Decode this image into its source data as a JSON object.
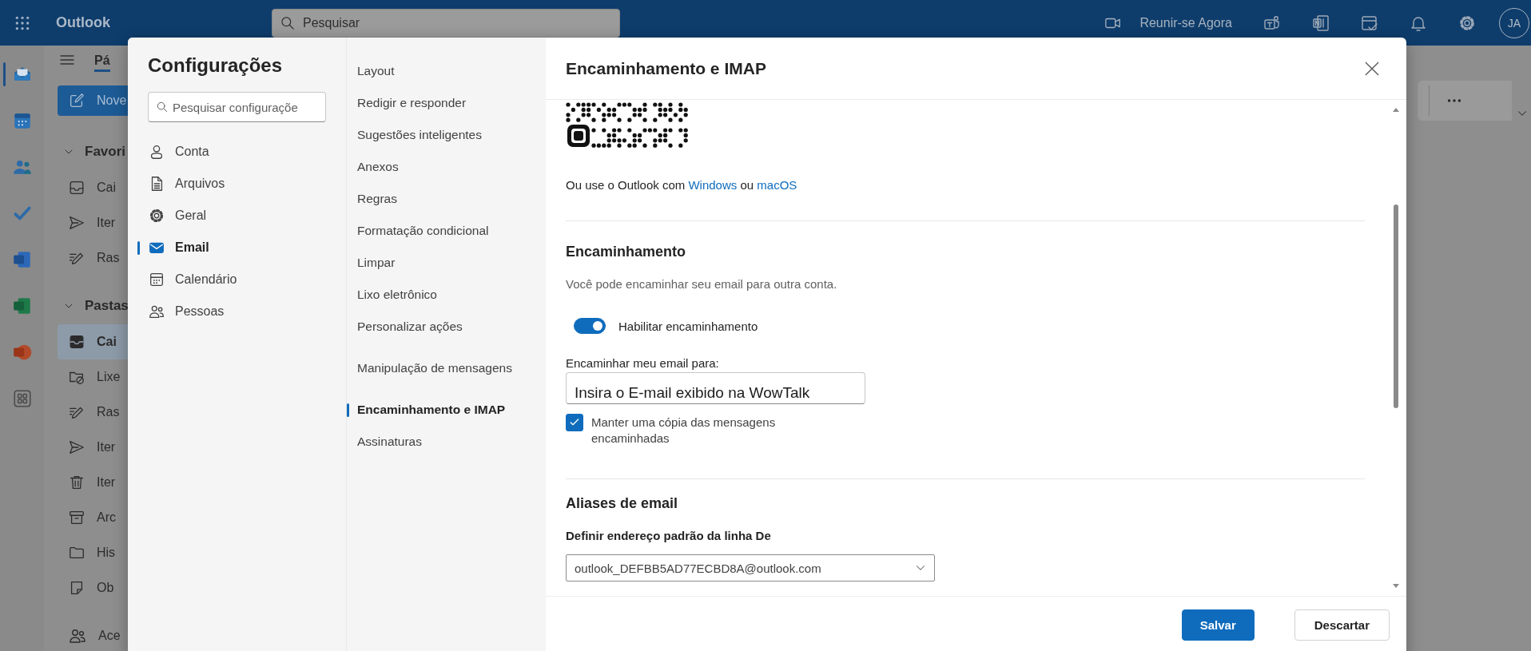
{
  "app": {
    "name": "Outlook",
    "search_placeholder": "Pesquisar",
    "meet_now": "Reunir-se Agora",
    "avatar": "JA",
    "toolbar_icons": [
      {
        "kind": "chat"
      },
      {
        "kind": "notebook"
      },
      {
        "kind": "task"
      },
      {
        "kind": "bell"
      },
      {
        "kind": "gear"
      }
    ]
  },
  "rail": [
    {
      "kind": "mail",
      "selected": true
    },
    {
      "kind": "calendar",
      "selected": false
    },
    {
      "kind": "people",
      "selected": false
    },
    {
      "kind": "check",
      "selected": false
    },
    {
      "kind": "doc",
      "selected": false
    },
    {
      "kind": "sheet",
      "selected": false
    },
    {
      "kind": "slides",
      "selected": false
    },
    {
      "kind": "apps",
      "selected": false
    }
  ],
  "folder_pane": {
    "tab": "Pá",
    "new_button": "Nove",
    "sections": [
      {
        "label": "Favori",
        "items": [
          {
            "kind": "inbox",
            "label": "Cai",
            "selected": false
          },
          {
            "kind": "send",
            "label": "Iter",
            "selected": false
          },
          {
            "kind": "draft",
            "label": "Ras",
            "selected": false
          }
        ]
      },
      {
        "label": "Pastas",
        "items": [
          {
            "kind": "inbox",
            "label": "Cai",
            "selected": true
          },
          {
            "kind": "junk",
            "label": "Lixe",
            "selected": false
          },
          {
            "kind": "draft",
            "label": "Ras",
            "selected": false
          },
          {
            "kind": "send",
            "label": "Iter",
            "selected": false
          },
          {
            "kind": "trash",
            "label": "Iter",
            "selected": false
          },
          {
            "kind": "archive",
            "label": "Arc",
            "selected": false
          },
          {
            "kind": "folder",
            "label": "His",
            "selected": false
          },
          {
            "kind": "note",
            "label": "Ob",
            "selected": false
          }
        ]
      }
    ],
    "footer_item": {
      "kind": "people",
      "label": "Ace"
    }
  },
  "settings": {
    "title": "Configurações",
    "search_placeholder": "Pesquisar configuraçõe",
    "categories": [
      {
        "kind": "person",
        "label": "Conta",
        "selected": false
      },
      {
        "kind": "doc",
        "label": "Arquivos",
        "selected": false
      },
      {
        "kind": "gear",
        "label": "Geral",
        "selected": false
      },
      {
        "kind": "mail",
        "label": "Email",
        "selected": true
      },
      {
        "kind": "calendar",
        "label": "Calendário",
        "selected": false
      },
      {
        "kind": "people",
        "label": "Pessoas",
        "selected": false
      }
    ],
    "subcategory_groups": [
      {
        "items": [
          {
            "label": "Layout",
            "selected": false
          },
          {
            "label": "Redigir e responder",
            "selected": false
          },
          {
            "label": "Sugestões inteligentes",
            "selected": false
          },
          {
            "label": "Anexos",
            "selected": false
          },
          {
            "label": "Regras",
            "selected": false
          },
          {
            "label": "Formatação condicional",
            "selected": false
          },
          {
            "label": "Limpar",
            "selected": false
          },
          {
            "label": "Lixo eletrônico",
            "selected": false
          },
          {
            "label": "Personalizar ações",
            "selected": false
          }
        ]
      },
      {
        "items": [
          {
            "label": "Manipulação de mensagens",
            "selected": false
          }
        ]
      },
      {
        "items": [
          {
            "label": "Encaminhamento e IMAP",
            "selected": true
          },
          {
            "label": "Assinaturas",
            "selected": false
          }
        ]
      }
    ]
  },
  "panel": {
    "title": "Encaminhamento e IMAP",
    "apps_note": [
      {
        "kind": "text",
        "text": "Ou use o Outlook com "
      },
      {
        "kind": "link",
        "text": "Windows"
      },
      {
        "kind": "text",
        "text": " ou "
      },
      {
        "kind": "link",
        "text": "macOS"
      }
    ],
    "forwarding": {
      "heading": "Encaminhamento",
      "description": "Você pode encaminhar seu email para outra conta.",
      "toggle": {
        "label": "Habilitar encaminhamento",
        "on": true
      },
      "address_label": "Encaminhar meu email para:",
      "address_value": "Insira o E-mail exibido na WowTalk",
      "keep_copy": {
        "label": "Manter uma cópia das mensagens encaminhadas",
        "checked": true
      }
    },
    "aliases": {
      "heading": "Aliases de email",
      "from_label": "Definir endereço padrão da linha De",
      "from_value": "outlook_DEFBB5AD77ECBD8A@outlook.com"
    },
    "buttons": [
      {
        "kind": "primary",
        "label": "Salvar"
      },
      {
        "kind": "secondary",
        "label": "Descartar"
      }
    ]
  }
}
